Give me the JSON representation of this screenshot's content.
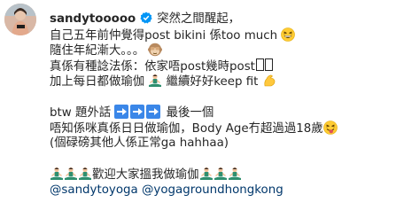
{
  "post": {
    "username": "sandytooooo",
    "lines": [
      "突然之間醒起，",
      "自己五年前仲覺得post bikini 係too much",
      "隨住年紀漸大。。。",
      "真係有種諗法係：依家唔post幾時post",
      "加上每日都做瑜伽",
      "繼續好好keep fit",
      "",
      "btw 題外話",
      "最後一個",
      "唔知係咪真係日日做瑜伽，Body Age冇超過過18歲",
      "(個碌磅其他人係正常ga hahhaa)",
      "",
      "歡迎大家搵我做瑜伽"
    ],
    "mentions": [
      "@sandytoyoga",
      "@yogagroundhongkong"
    ]
  },
  "icons": {
    "verified": "verified-badge-icon",
    "grin": "grinning-squinting-face-emoji",
    "monkey": "see-no-evil-monkey-emoji",
    "yoga": "person-in-lotus-position-emoji",
    "muscle": "flexed-biceps-emoji",
    "arrow": "right-arrow-emoji",
    "tongue": "squinting-face-with-tongue-emoji",
    "missing_glyph": "missing-glyph-box"
  },
  "colors": {
    "text": "#262626",
    "mention": "#00376b",
    "verified": "#0095f6",
    "arrow": "#3b87e8",
    "emoji_face": "#ffcc33",
    "yoga_outfit": "#2f8f6f"
  }
}
